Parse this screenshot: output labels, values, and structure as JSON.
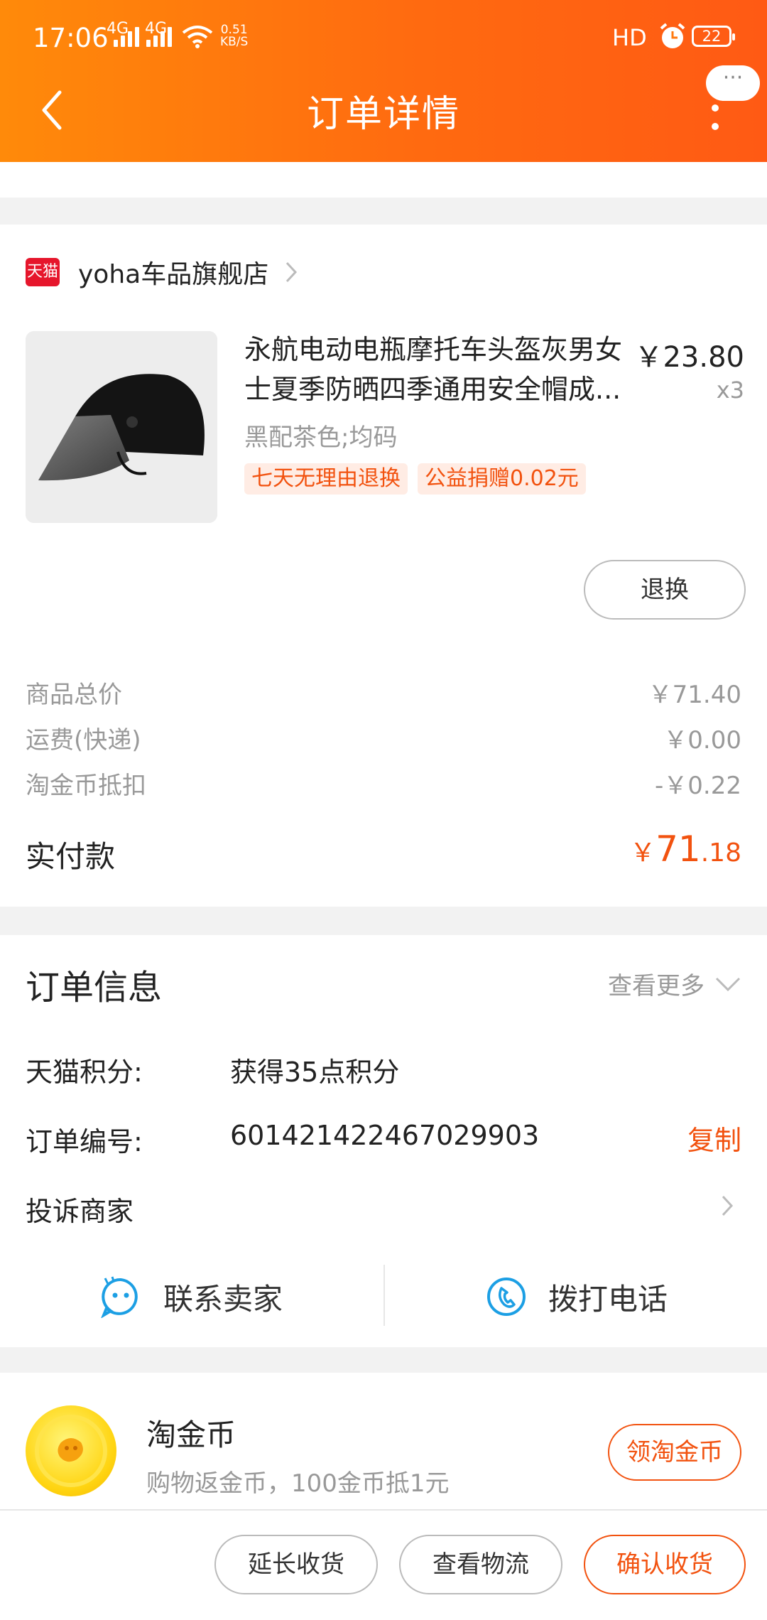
{
  "status_bar": {
    "time": "17:06",
    "net_type_1": "4G",
    "net_type_2": "4G",
    "speed_value": "0.51",
    "speed_unit": "KB/S",
    "hd": "HD",
    "battery": "22"
  },
  "header": {
    "title": "订单详情",
    "bubble": "···"
  },
  "shop": {
    "badge": "天猫",
    "name": "yoha车品旗舰店"
  },
  "product": {
    "title": "永航电动电瓶摩托车头盔灰男女士夏季防晒四季通用安全帽成...",
    "price": "￥23.80",
    "quantity": "x3",
    "spec": "黑配茶色;均码",
    "tags": [
      "七天无理由退换",
      "公益捐赠0.02元"
    ],
    "exchange_label": "退换"
  },
  "summary": {
    "rows": [
      {
        "label": "商品总价",
        "value": "￥71.40"
      },
      {
        "label": "运费(快递)",
        "value": "￥0.00"
      },
      {
        "label": "淘金币抵扣",
        "value": "-￥0.22"
      }
    ],
    "paid_label": "实付款",
    "paid_currency": "￥",
    "paid_int": "71",
    "paid_dec": ".18"
  },
  "order_info": {
    "title": "订单信息",
    "more": "查看更多",
    "points_label": "天猫积分:",
    "points_value": "获得35点积分",
    "order_no_label": "订单编号:",
    "order_no_value": "601421422467029903",
    "copy_label": "复制",
    "complain_label": "投诉商家"
  },
  "contact": {
    "seller": "联系卖家",
    "phone": "拨打电话"
  },
  "coin": {
    "title": "淘金币",
    "subtitle": "购物返金币，100金币抵1元",
    "button": "领淘金币"
  },
  "actions": {
    "extend": "延长收货",
    "logistics": "查看物流",
    "confirm": "确认收货"
  },
  "colors": {
    "accent": "#f2520f",
    "header_start": "#ff8a0a",
    "header_end": "#ff5a14",
    "tmall_red": "#e6162c"
  }
}
